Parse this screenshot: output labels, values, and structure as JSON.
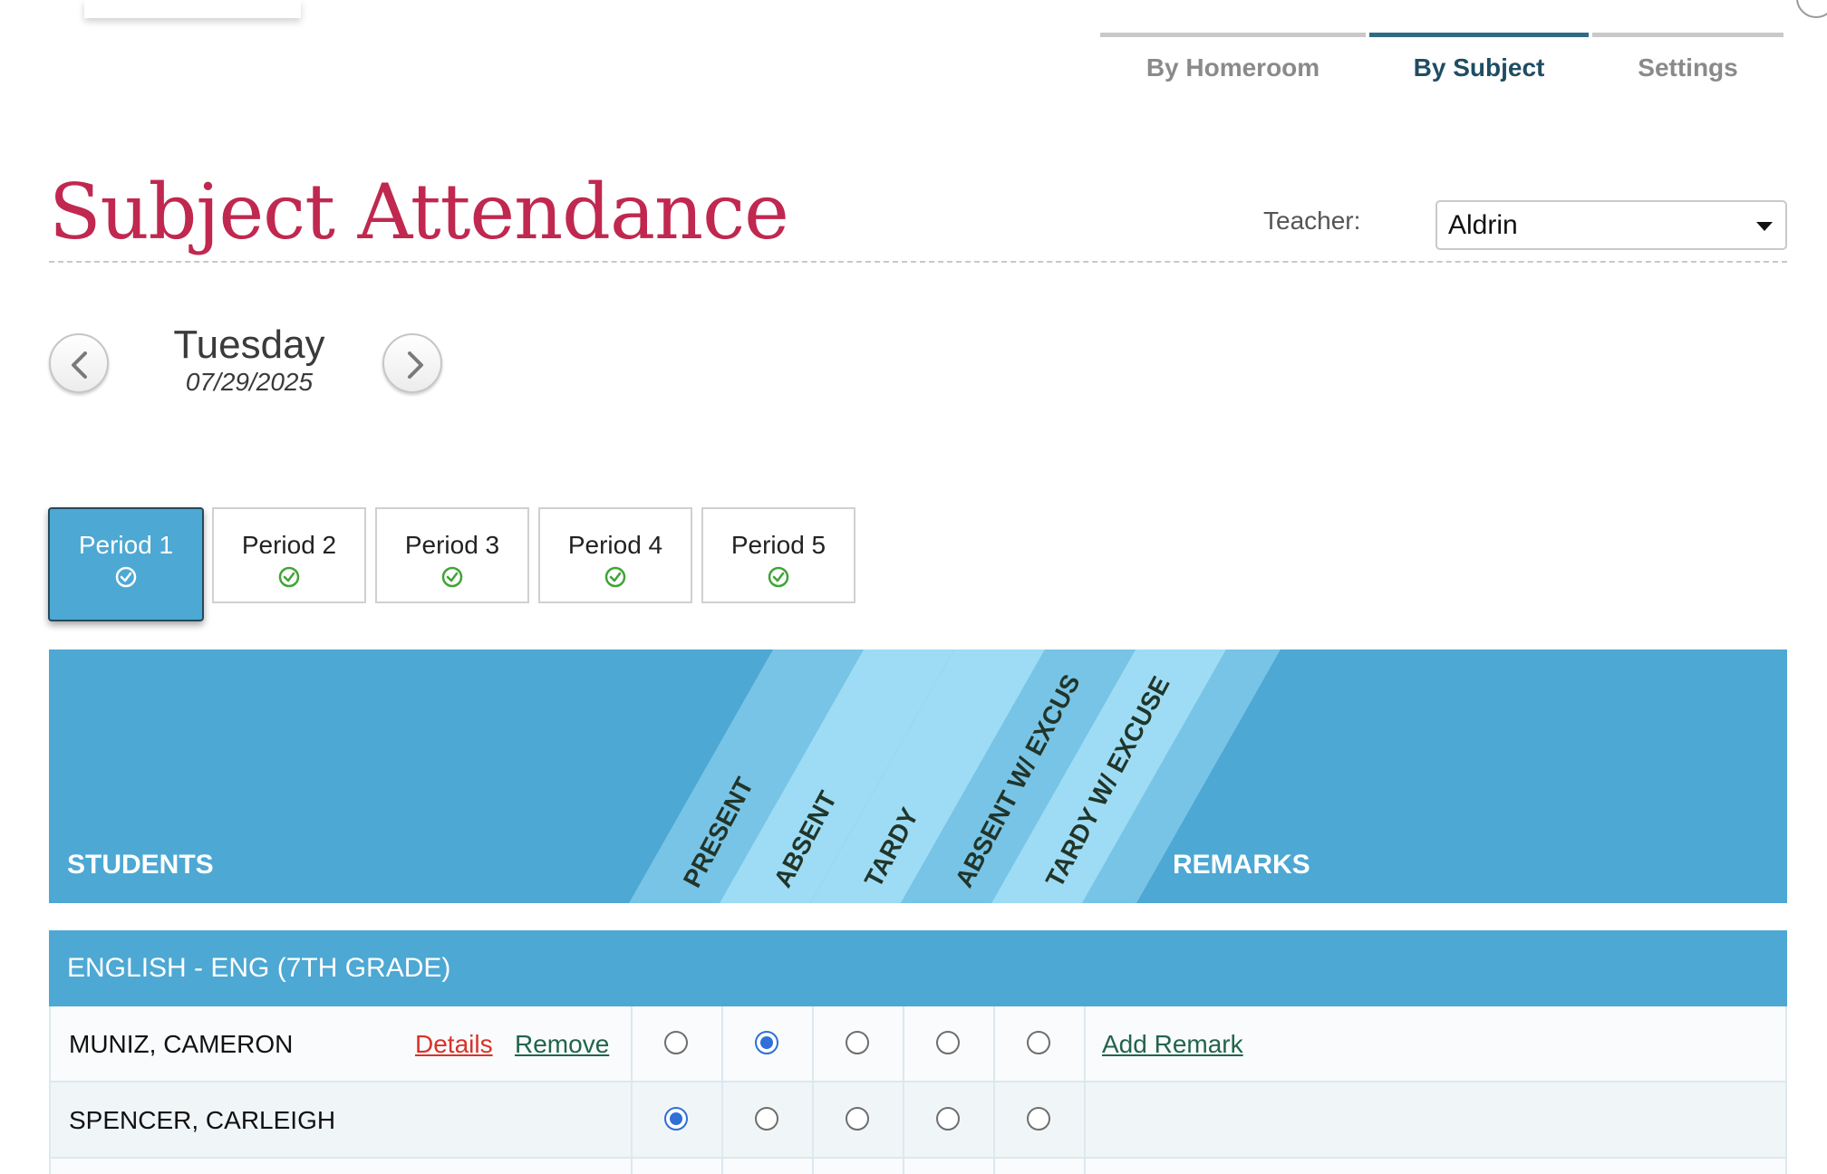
{
  "nav": {
    "tabs": [
      {
        "label": "By Homeroom",
        "active": false
      },
      {
        "label": "By Subject",
        "active": true
      },
      {
        "label": "Settings",
        "active": false
      }
    ]
  },
  "header": {
    "title": "Subject Attendance",
    "teacher_label": "Teacher:",
    "teacher_value": "Aldrin"
  },
  "date": {
    "day": "Tuesday",
    "date": "07/29/2025"
  },
  "periods": [
    {
      "label": "Period 1",
      "active": true,
      "complete": true
    },
    {
      "label": "Period 2",
      "active": false,
      "complete": true
    },
    {
      "label": "Period 3",
      "active": false,
      "complete": true
    },
    {
      "label": "Period 4",
      "active": false,
      "complete": true
    },
    {
      "label": "Period 5",
      "active": false,
      "complete": true
    }
  ],
  "table": {
    "students_header": "STUDENTS",
    "remarks_header": "REMARKS",
    "status_columns": [
      "PRESENT",
      "ABSENT",
      "TARDY",
      "ABSENT W/ EXCUS",
      "TARDY W/ EXCUSE"
    ],
    "group": "ENGLISH - ENG (7TH GRADE)",
    "rows": [
      {
        "name": "MUNIZ, CAMERON",
        "details_label": "Details",
        "remove_label": "Remove",
        "remark_label": "Add Remark",
        "selected": "ABSENT"
      },
      {
        "name": "SPENCER, CARLEIGH",
        "selected": "PRESENT"
      }
    ]
  },
  "colors": {
    "accent": "#4da8d3",
    "title": "#c0284f",
    "radio_selected": "#2f6fd6",
    "check_green": "#3fa535"
  }
}
